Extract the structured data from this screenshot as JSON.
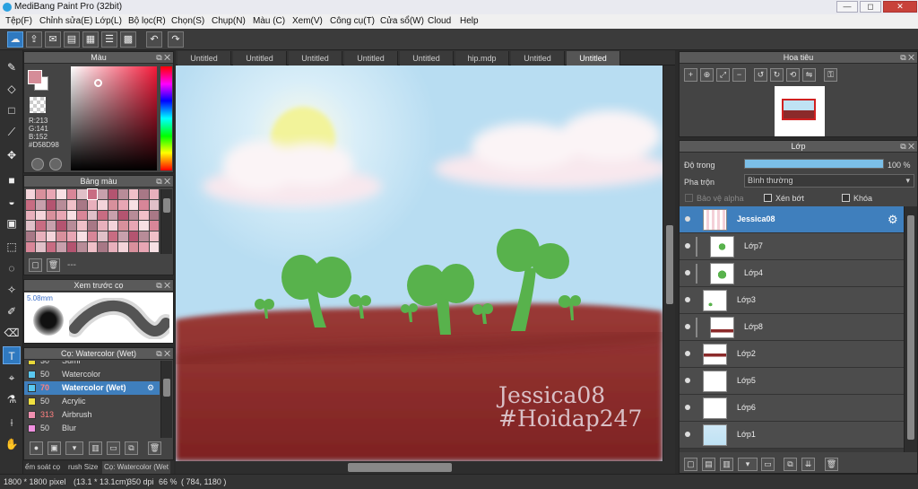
{
  "window": {
    "title": "MediBang Paint Pro (32bit)",
    "minimize": "—",
    "maximize": "◻",
    "close": "✕"
  },
  "menu": [
    "Tệp(F)",
    "Chỉnh sửa(E)",
    "Lớp(L)",
    "Bộ lọc(R)",
    "Chọn(S)",
    "Chụp(N)",
    "Màu (C)",
    "Xem(V)",
    "Công cụ(T)",
    "Cửa sổ(W)",
    "Cloud",
    "Help"
  ],
  "color_panel": {
    "title": "Màu",
    "r": "R:213",
    "g": "G:141",
    "b": "B:152",
    "hex": "#D58D98",
    "current": "#D58D98"
  },
  "palette_panel": {
    "title": "Bảng màu",
    "status": "---"
  },
  "brush_preview": {
    "title": "Xem trước cọ",
    "size": "5.08mm"
  },
  "brush_list": {
    "title": "Cọ: Watercolor (Wet)",
    "items": [
      {
        "size": "30",
        "name": "Sumi",
        "color": "#e8d83a"
      },
      {
        "size": "50",
        "name": "Watercolor",
        "color": "#5ac8f0"
      },
      {
        "size": "70",
        "name": "Watercolor (Wet)",
        "color": "#5ac8f0",
        "selected": true
      },
      {
        "size": "50",
        "name": "Acrylic",
        "color": "#f0e040"
      },
      {
        "size": "313",
        "name": "Airbrush",
        "color": "#f090b0"
      },
      {
        "size": "50",
        "name": "Blur",
        "color": "#f090e0"
      }
    ]
  },
  "bottom_tabs": [
    "ểm soát cọ",
    "rush Size",
    "Cọ: Watercolor (Wet"
  ],
  "document_tabs": [
    "Untitled",
    "Untitled",
    "Untitled",
    "Untitled",
    "Untitled",
    "hip.mdp",
    "Untitled",
    "Untitled"
  ],
  "canvas_text": {
    "line1": "Jessica08",
    "line2": "#Hoidap247"
  },
  "navigator": {
    "title": "Hoa tiêu"
  },
  "layers_panel": {
    "title": "Lớp",
    "opacity_label": "Độ trong",
    "opacity_value": "100 %",
    "opacity_fraction": 1.0,
    "blend_label": "Pha trộn",
    "blend_value": "Bình thường",
    "protect_alpha": "Bảo vệ alpha",
    "clipping": "Xén bớt",
    "lock": "Khóa",
    "layers": [
      {
        "name": "Jessica08",
        "selected": true
      },
      {
        "name": "Lớp7"
      },
      {
        "name": "Lớp4"
      },
      {
        "name": "Lớp3"
      },
      {
        "name": "Lớp8"
      },
      {
        "name": "Lớp2"
      },
      {
        "name": "Lớp5"
      },
      {
        "name": "Lớp6"
      },
      {
        "name": "Lớp1"
      }
    ]
  },
  "status": {
    "size": "1800 * 1800 pixel",
    "physical": "(13.1 * 13.1cm)",
    "dpi": "350 dpi",
    "zoom": "66 %",
    "coords": "( 784, 1180 )"
  },
  "colors": {
    "accent": "#2f79c0",
    "ground": "#8b2a2a",
    "sky": "#bfe2f4",
    "sprout": "#5cb85c"
  }
}
